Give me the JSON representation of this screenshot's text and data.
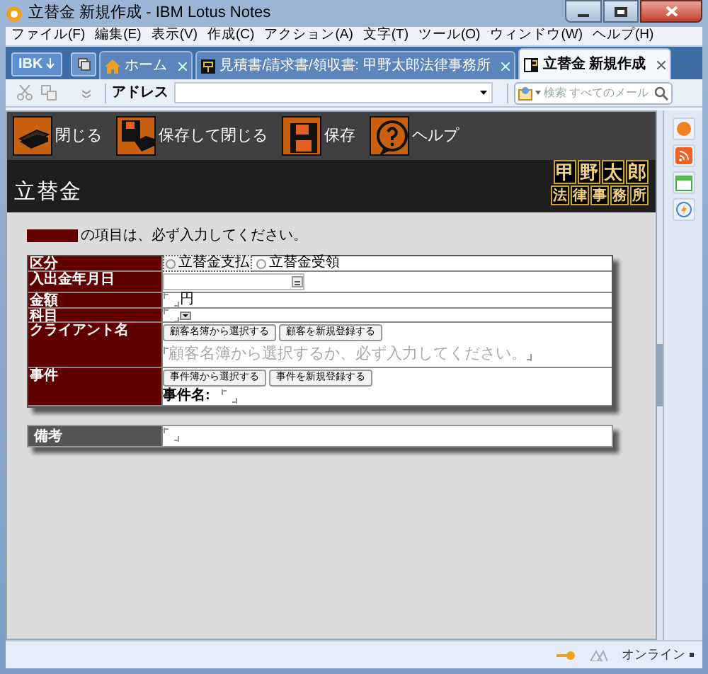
{
  "window": {
    "title": "立替金 新規作成 - IBM Lotus Notes"
  },
  "menu": [
    "ファイル(F)",
    "編集(E)",
    "表示(V)",
    "作成(C)",
    "アクション(A)",
    "文字(T)",
    "ツール(O)",
    "ウィンドウ(W)",
    "ヘルプ(H)"
  ],
  "open_button": {
    "label": "IBK"
  },
  "tabs": [
    {
      "label": "ホーム",
      "kind": "home",
      "selected": false
    },
    {
      "label": "見積書/請求書/領収書: 甲野太郎法律事務所",
      "kind": "database",
      "selected": false
    },
    {
      "label": "立替金 新規作成",
      "kind": "document",
      "selected": true
    }
  ],
  "toolbar": {
    "address_label": "アドレス",
    "search_placeholder": "検索 すべてのメール"
  },
  "actions": [
    {
      "label": "閉じる",
      "kind": "close"
    },
    {
      "label": "保存して閉じる",
      "kind": "save_close"
    },
    {
      "label": "保存",
      "kind": "save"
    },
    {
      "label": "ヘルプ",
      "kind": "help"
    }
  ],
  "form": {
    "title": "立替金",
    "logo_rows": [
      [
        "甲",
        "野",
        "太",
        "郎"
      ],
      [
        "法",
        "律",
        "事",
        "務",
        "所"
      ]
    ],
    "required_note": "の項目は、必ず入力してください。",
    "fields": [
      {
        "label": "区分",
        "kind": "radio",
        "options": [
          {
            "label": "立替金支払",
            "selected": false,
            "focused": true
          },
          {
            "label": "立替金受領",
            "selected": false,
            "focused": false
          }
        ]
      },
      {
        "label": "入出金年月日",
        "kind": "date"
      },
      {
        "label": "金額",
        "kind": "amount",
        "unit": "円"
      },
      {
        "label": "科目",
        "kind": "dropdown"
      },
      {
        "label": "クライアント名",
        "kind": "lookup",
        "buttons": [
          "顧客名簿から選択する",
          "顧客を新規登録する"
        ],
        "placeholder": "顧客名簿から選択するか、必ず入力してください。"
      },
      {
        "label": "事件",
        "kind": "lookup",
        "buttons": [
          "事件簿から選択する",
          "事件を新規登録する"
        ],
        "sublabel": "事件名:"
      }
    ],
    "notes": {
      "label": "備考"
    }
  },
  "status_bar": {
    "status": "オンライン"
  }
}
